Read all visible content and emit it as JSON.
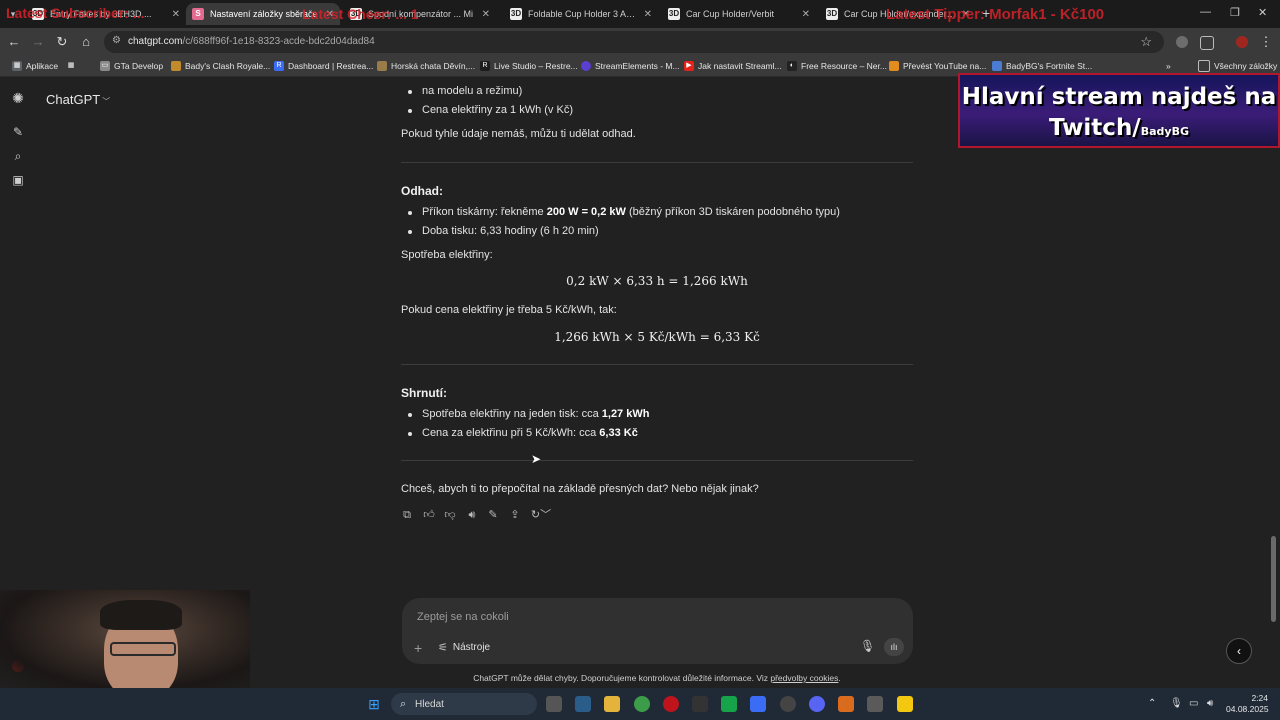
{
  "browser": {
    "tabs": [
      {
        "title": "Entry Fakes by 3EH3D ...",
        "favicon": "3D"
      },
      {
        "title": "Nastavení záložky sběrače",
        "favicon": "S",
        "active": true
      },
      {
        "title": "Spodní kompenzátor ... Mi",
        "favicon": "3D"
      },
      {
        "title": "Foldable Cup Holder 3 ADNT",
        "favicon": "3D"
      },
      {
        "title": "Car Cup Holder/Verbit",
        "favicon": "3D"
      },
      {
        "title": "Car Cup Holder/expander for",
        "favicon": "3D"
      }
    ],
    "new_tab": "+",
    "overlay_texts": [
      "Latest Subscriber: ... ",
      "Latest Cheer: ... 1",
      "Latest Tipper: Morfak1 - Kč100"
    ],
    "url_host": "chatgpt.com",
    "url_path": "/c/688ff96f-1e18-8323-acde-bdc2d04dad84",
    "bookmarks": [
      {
        "label": "Aplikace",
        "icon": "grid-icon",
        "color": "#5f6368"
      },
      {
        "label": "GTa Develop",
        "icon": "folder-icon",
        "color": "#8a8a8a"
      },
      {
        "label": "Bady's Clash Royale...",
        "icon": "clash-icon",
        "color": "#c18a2a"
      },
      {
        "label": "Dashboard | Restrea...",
        "icon": "restream-icon",
        "color": "#3b6cf6"
      },
      {
        "label": "Horská chata Děvín,...",
        "icon": "house-icon",
        "color": "#9a7b4a"
      },
      {
        "label": "Live Studio – Restre...",
        "icon": "restream-icon",
        "color": "#1c1c1c"
      },
      {
        "label": "StreamElements - M...",
        "icon": "streamelements-icon",
        "color": "#5b3fd1"
      },
      {
        "label": "Jak nastavit Streaml...",
        "icon": "youtube-icon",
        "color": "#e62117"
      },
      {
        "label": "Free Resource – Ner...",
        "icon": "nerd-icon",
        "color": "#222"
      },
      {
        "label": "Převést YouTube na...",
        "icon": "converter-icon",
        "color": "#e28b1e"
      },
      {
        "label": "BadyBG's Fortnite St...",
        "icon": "fortnite-icon",
        "color": "#4a7cd1"
      }
    ],
    "bookmarks_more": "»",
    "all_bookmarks": "Všechny záložky"
  },
  "app": {
    "model_label": "ChatGPT",
    "message": {
      "partial_list": [
        "na modelu a režimu)",
        "Cena elektřiny za 1 kWh (v Kč)"
      ],
      "estimate_note": "Pokud tyhle údaje nemáš, můžu ti udělat odhad.",
      "odhad_heading": "Odhad:",
      "odhad_items": [
        {
          "pre": "Příkon tiskárny: řekněme ",
          "bold": "200 W = 0,2 kW",
          "post": " (běžný příkon 3D tiskáren podobného typu)"
        },
        {
          "pre": "Doba tisku: 6,33 hodiny (6 h 20 min)",
          "bold": "",
          "post": ""
        }
      ],
      "consumption_label": "Spotřeba elektřiny:",
      "formula1": "0,2 kW × 6,33 h = 1,266 kWh",
      "price_label": "Pokud cena elektřiny je třeba 5 Kč/kWh, tak:",
      "formula2": "1,266 kWh × 5 Kč/kWh = 6,33 Kč",
      "summary_heading": "Shrnutí:",
      "summary_items": [
        {
          "pre": "Spotřeba elektřiny na jeden tisk: cca ",
          "bold": "1,27 kWh"
        },
        {
          "pre": "Cena za elektřinu při 5 Kč/kWh: cca ",
          "bold": "6,33 Kč"
        }
      ],
      "followup": "Chceš, abych ti to přepočítal na základě přesných dat? Nebo nějak jinak?"
    },
    "composer": {
      "placeholder": "Zeptej se na cokoli",
      "tools_label": "Nástroje"
    },
    "disclaimer_pre": "ChatGPT může dělat chyby. Doporučujeme kontrolovat důležité informace. Viz ",
    "disclaimer_link": "předvolby cookies",
    "disclaimer_post": "."
  },
  "overlay": {
    "banner_line1": "Hlavní stream najdeš na",
    "banner_line2": "Twitch/",
    "banner_small": "BadyBG"
  },
  "taskbar": {
    "search_label": "Hledat",
    "time": "2:24",
    "date": "04.08.2025"
  }
}
